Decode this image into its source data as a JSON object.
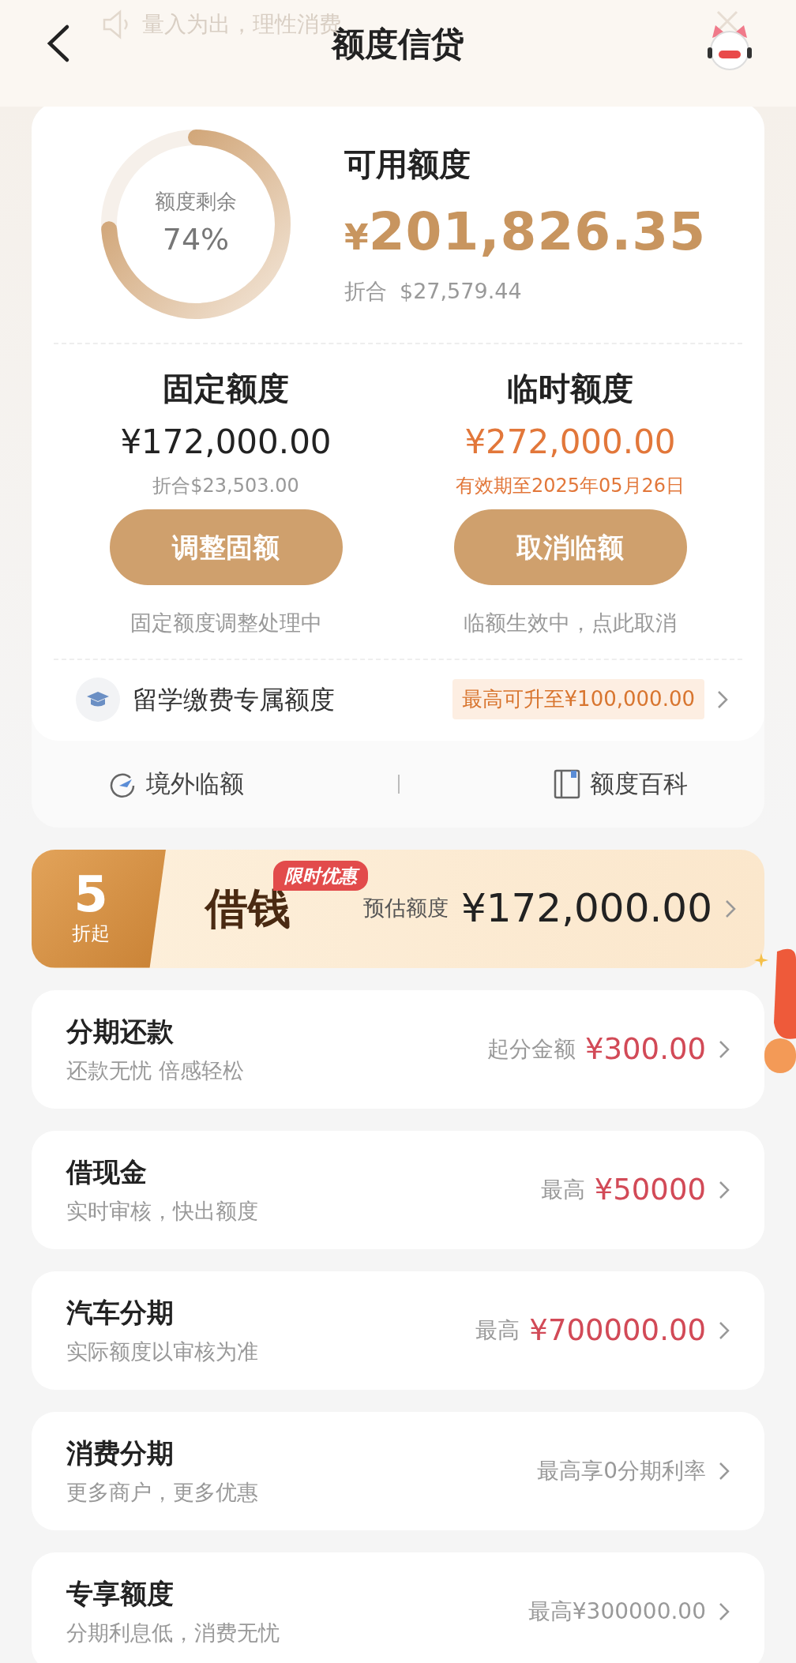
{
  "header": {
    "notice": "量入为出，理性消费",
    "title": "额度信贷"
  },
  "summary": {
    "ring_label": "额度剩余",
    "ring_value": "74%",
    "level": 0.74,
    "available_label": "可用额度",
    "available_currency": "¥",
    "available_amount": "201,826.35",
    "converted_label": "折合",
    "converted_amount": "$27,579.44"
  },
  "limits": [
    {
      "kind": "fixed",
      "title": "固定额度",
      "amount": "¥172,000.00",
      "note": "折合$23,503.00",
      "button": "调整固额",
      "status": "固定额度调整处理中"
    },
    {
      "kind": "temporary",
      "title": "临时额度",
      "amount": "¥272,000.00",
      "note": "有效期至2025年05月26日",
      "button": "取消临额",
      "status": "临额生效中，点此取消"
    }
  ],
  "study": {
    "label": "留学缴费专属额度",
    "tag": "最高可升至¥100,000.00"
  },
  "links": [
    {
      "kind": "overseas",
      "label": "境外临额"
    },
    {
      "kind": "guide",
      "label": "额度百科"
    }
  ],
  "promo": {
    "discount": "5",
    "discount_unit": "折起",
    "title": "借钱",
    "badge": "限时优惠",
    "estimate_label": "预估额度",
    "estimate_amount": "¥172,000.00"
  },
  "products": [
    {
      "title": "分期还款",
      "subtitle": "还款无忧 倍感轻松",
      "label": "起分金额",
      "amount": "¥300.00"
    },
    {
      "title": "借现金",
      "subtitle": "实时审核，快出额度",
      "label": "最高",
      "amount": "¥50000"
    },
    {
      "title": "汽车分期",
      "subtitle": "实际额度以审核为准",
      "label": "最高",
      "amount": "¥700000.00"
    },
    {
      "title": "消费分期",
      "subtitle": "更多商户，更多优惠",
      "label": "最高享0分期利率"
    },
    {
      "title": "专享额度",
      "subtitle": "分期利息低，消费无忧",
      "label": "最高¥300000.00"
    }
  ]
}
